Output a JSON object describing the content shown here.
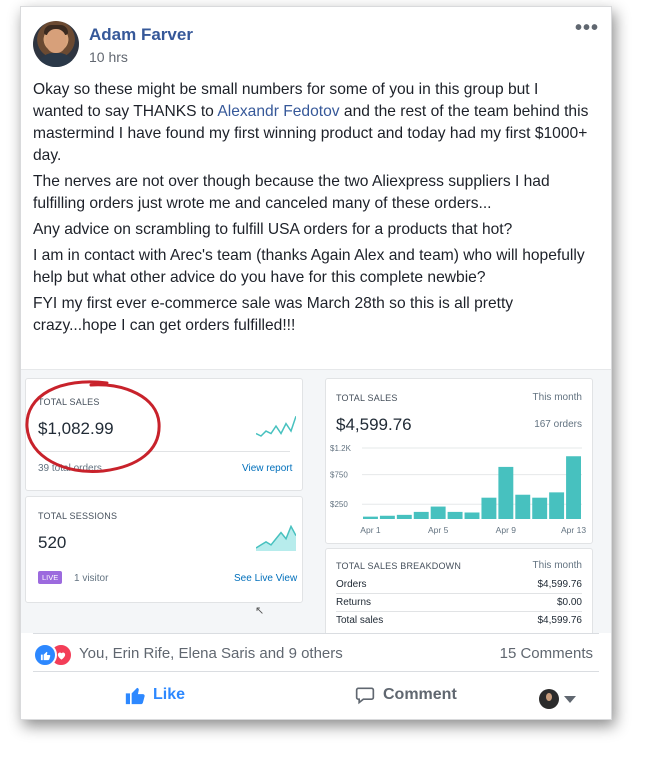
{
  "post": {
    "author": "Adam Farver",
    "time": "10 hrs",
    "paragraphs": [
      {
        "before": "Okay so these might be small numbers for some of you in this group but I wanted to say THANKS to ",
        "mention": "Alexandr Fedotov",
        "after": " and the rest of the team behind this mastermind I have found my first winning product and today had my first $1000+ day."
      },
      {
        "text": "The nerves are not over though because the two Aliexpress suppliers I had fulfilling orders just wrote me and canceled many of these orders..."
      },
      {
        "text": "Any advice on scrambling to fulfill USA orders for a products that hot?"
      },
      {
        "text": "I am in contact with Arec's team (thanks Again Alex and team) who will hopefully help but what other advice do you have for this complete newbie?"
      },
      {
        "text": "FYI my first ever e-commerce sale was March 28th so this is all pretty crazy...hope I can get orders fulfilled!!!"
      }
    ]
  },
  "screenshot": {
    "total_sales_card": {
      "label": "TOTAL SALES",
      "value": "$1,082.99",
      "orders": "39 total orders",
      "link": "View report"
    },
    "sessions_card": {
      "label": "TOTAL SESSIONS",
      "value": "520",
      "badge": "LIVE",
      "visitors": "1 visitor",
      "link": "See Live View"
    },
    "chart_card": {
      "label": "TOTAL SALES",
      "period": "This month",
      "value": "$4,599.76",
      "orders": "167 orders"
    },
    "breakdown": {
      "label": "TOTAL SALES BREAKDOWN",
      "period": "This month",
      "rows": [
        {
          "name": "Orders",
          "value": "$4,599.76"
        },
        {
          "name": "Returns",
          "value": "$0.00"
        },
        {
          "name": "Total sales",
          "value": "$4,599.76"
        }
      ]
    },
    "annotation_color": "#c8222b"
  },
  "chart_data": {
    "type": "bar",
    "title": "TOTAL SALES",
    "categories": [
      "Apr 1",
      "Apr 2",
      "Apr 3",
      "Apr 4",
      "Apr 5",
      "Apr 6",
      "Apr 7",
      "Apr 8",
      "Apr 9",
      "Apr 10",
      "Apr 11",
      "Apr 12",
      "Apr 13"
    ],
    "x_tick_labels": [
      "Apr 1",
      "Apr 5",
      "Apr 9",
      "Apr 13"
    ],
    "y_tick_labels": [
      "$1.2K",
      "$750",
      "$250"
    ],
    "y_ticks": [
      1200,
      750,
      250
    ],
    "values": [
      40,
      55,
      70,
      120,
      210,
      120,
      110,
      360,
      880,
      410,
      360,
      450,
      1060
    ],
    "ylim": [
      0,
      1250
    ],
    "bar_color": "#47c1bf"
  },
  "sparklines": {
    "sales": [
      2,
      1,
      3,
      2,
      5,
      2,
      6,
      3,
      9
    ],
    "sessions": [
      1,
      2,
      3,
      2,
      4,
      6,
      4,
      8,
      5
    ],
    "color": "#47c1bf"
  },
  "reactions": {
    "text": "You, Erin Rife, Elena Saris and 9 others",
    "comments": "15 Comments",
    "like_color": "#2d88ff",
    "love_color": "#f33e58"
  },
  "actions": {
    "like": "Like",
    "comment": "Comment"
  }
}
